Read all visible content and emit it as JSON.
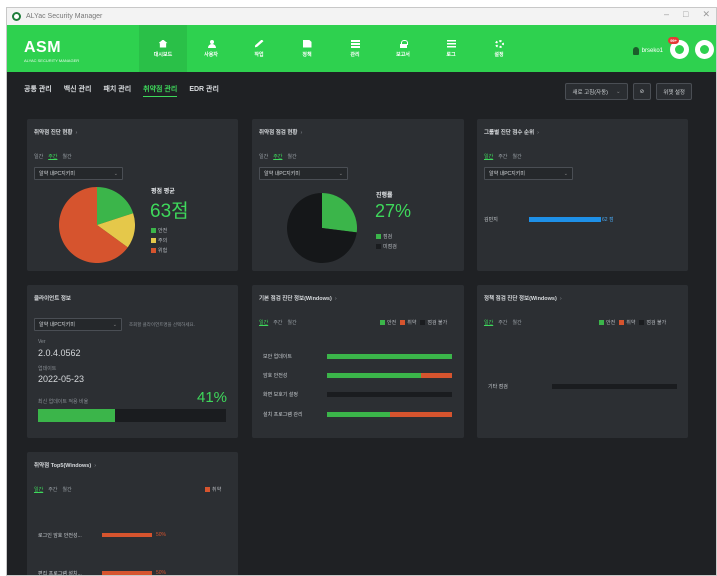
{
  "app": {
    "title": "ALYac Security Manager"
  },
  "brand": {
    "name": "ASM",
    "subtitle": "ALYAC SECURITY MANAGER"
  },
  "nav": [
    {
      "label": "대시보드",
      "icon": "home-icon"
    },
    {
      "label": "사용자",
      "icon": "user-icon"
    },
    {
      "label": "작업",
      "icon": "pen-icon"
    },
    {
      "label": "정책",
      "icon": "document-icon"
    },
    {
      "label": "관리",
      "icon": "list-icon"
    },
    {
      "label": "보고서",
      "icon": "lock-icon"
    },
    {
      "label": "로그",
      "icon": "menu-icon"
    },
    {
      "label": "설정",
      "icon": "gear-icon"
    }
  ],
  "header": {
    "user": "brseko1",
    "notification_badge": "99+"
  },
  "tabs": [
    "공통 관리",
    "백신 관리",
    "패치 관리",
    "취약점 관리",
    "EDR 관리"
  ],
  "active_tab": "취약점 관리",
  "toolbar": {
    "refresh_select": "새로 고침(자동)",
    "layout_button": "위젯 설정"
  },
  "period_labels": [
    "일간",
    "주간",
    "월간"
  ],
  "panels": {
    "vuln_status": {
      "title": "취약점 진단 현황",
      "select": "알약 내PC지키미",
      "avg_label": "평점 평균",
      "avg_value": "63점",
      "legend": [
        "안전",
        "주의",
        "위험"
      ]
    },
    "vuln_check": {
      "title": "취약점 점검 현황",
      "select": "알약 내PC지키미",
      "progress_label": "진행률",
      "progress_value": "27%",
      "legend": [
        "점검",
        "미점검"
      ]
    },
    "group_rank": {
      "title": "그룹별 진단 점수 순위",
      "select": "알약 내PC지키미",
      "rows": [
        {
          "name": "김민지",
          "value_label": "62 점",
          "value": 62
        }
      ]
    },
    "client": {
      "title": "클라이언트 정보",
      "select": "알약 내PC지키미",
      "hint": "조회할 클라이언트명을 선택하세요.",
      "ver_label": "Ver",
      "ver_value": "2.0.4.0562",
      "update_label": "업데이트",
      "update_value": "2022-05-23",
      "rate_label": "최신 업데이트 적용 비율",
      "rate_value": "41%"
    },
    "basic_check": {
      "title": "기본 점검 진단 정보(Windows)",
      "legend": [
        "안전",
        "취약",
        "점검 불가"
      ],
      "rows": [
        {
          "label": "보안 업데이트",
          "safe": 100,
          "vuln": 0
        },
        {
          "label": "암호 안전성",
          "safe": 75,
          "vuln": 25
        },
        {
          "label": "화면 보호기 설정",
          "safe": 0,
          "vuln": 0
        },
        {
          "label": "설치 프로그램 관리",
          "safe": 50,
          "vuln": 50
        }
      ]
    },
    "policy_check": {
      "title": "정책 점검 진단 정보(Windows)",
      "legend": [
        "안전",
        "취약",
        "점검 불가"
      ],
      "rows": [
        {
          "label": "기타 점검",
          "safe": 0,
          "vuln": 0
        }
      ]
    },
    "top5": {
      "title": "취약점 Top5(Windows)",
      "legend": [
        "취약"
      ],
      "rows": [
        {
          "label": "로그인 암호 안전성...",
          "value_label": "50%",
          "value": 50
        },
        {
          "label": "편집 프로그램 설치...",
          "value_label": "50%",
          "value": 50
        }
      ]
    }
  },
  "colors": {
    "accent": "#2ed14f",
    "safe": "#3bb54a",
    "warn": "#e5c84a",
    "danger": "#d6542e",
    "blue": "#1e90e8",
    "panel": "#2c2f33",
    "bg": "#1f2124"
  },
  "pie_status": [
    {
      "name": "안전",
      "value": 20
    },
    {
      "name": "주의",
      "value": 15
    },
    {
      "name": "위험",
      "value": 65
    }
  ],
  "pie_check": [
    {
      "name": "점검",
      "value": 27
    },
    {
      "name": "미점검",
      "value": 73
    }
  ]
}
